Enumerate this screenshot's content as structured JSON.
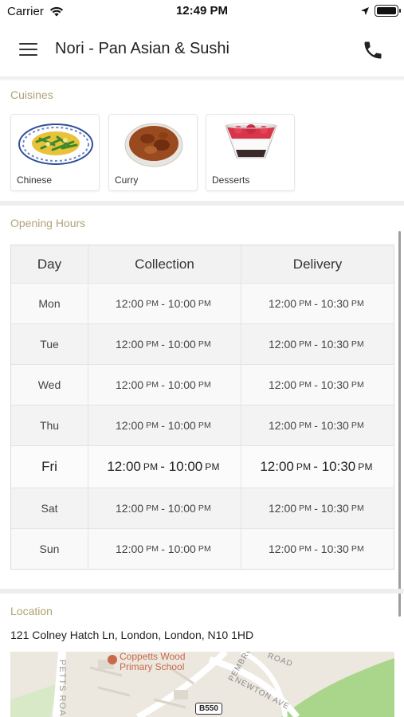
{
  "status_bar": {
    "carrier": "Carrier",
    "time": "12:49 PM"
  },
  "header": {
    "title": "Nori - Pan Asian & Sushi",
    "menu_icon": "hamburger-menu-icon",
    "phone_icon": "phone-icon"
  },
  "cuisines": {
    "heading": "Cuisines",
    "items": [
      {
        "label": "Chinese",
        "image": "stir-fry-plate-image"
      },
      {
        "label": "Curry",
        "image": "curry-bowl-image"
      },
      {
        "label": "Desserts",
        "image": "dessert-glass-image"
      }
    ]
  },
  "opening_hours": {
    "heading": "Opening Hours",
    "columns": [
      "Day",
      "Collection",
      "Delivery"
    ],
    "rows": [
      {
        "day": "Mon",
        "collection": {
          "open": "12:00",
          "open_ampm": "PM",
          "close": "10:00",
          "close_ampm": "PM"
        },
        "delivery": {
          "open": "12:00",
          "open_ampm": "PM",
          "close": "10:30",
          "close_ampm": "PM"
        }
      },
      {
        "day": "Tue",
        "collection": {
          "open": "12:00",
          "open_ampm": "PM",
          "close": "10:00",
          "close_ampm": "PM"
        },
        "delivery": {
          "open": "12:00",
          "open_ampm": "PM",
          "close": "10:30",
          "close_ampm": "PM"
        }
      },
      {
        "day": "Wed",
        "collection": {
          "open": "12:00",
          "open_ampm": "PM",
          "close": "10:00",
          "close_ampm": "PM"
        },
        "delivery": {
          "open": "12:00",
          "open_ampm": "PM",
          "close": "10:30",
          "close_ampm": "PM"
        }
      },
      {
        "day": "Thu",
        "collection": {
          "open": "12:00",
          "open_ampm": "PM",
          "close": "10:00",
          "close_ampm": "PM"
        },
        "delivery": {
          "open": "12:00",
          "open_ampm": "PM",
          "close": "10:30",
          "close_ampm": "PM"
        }
      },
      {
        "day": "Fri",
        "collection": {
          "open": "12:00",
          "open_ampm": "PM",
          "close": "10:00",
          "close_ampm": "PM"
        },
        "delivery": {
          "open": "12:00",
          "open_ampm": "PM",
          "close": "10:30",
          "close_ampm": "PM"
        }
      },
      {
        "day": "Sat",
        "collection": {
          "open": "12:00",
          "open_ampm": "PM",
          "close": "10:00",
          "close_ampm": "PM"
        },
        "delivery": {
          "open": "12:00",
          "open_ampm": "PM",
          "close": "10:30",
          "close_ampm": "PM"
        }
      },
      {
        "day": "Sun",
        "collection": {
          "open": "12:00",
          "open_ampm": "PM",
          "close": "10:00",
          "close_ampm": "PM"
        },
        "delivery": {
          "open": "12:00",
          "open_ampm": "PM",
          "close": "10:30",
          "close_ampm": "PM"
        }
      }
    ]
  },
  "location": {
    "heading": "Location",
    "address": "121 Colney Hatch Ln, London, London, N10 1HD",
    "map": {
      "poi_line1": "Coppetts Wood",
      "poi_line2": "Primary School",
      "roads": [
        "PETTS ROAD",
        "PEMBROKE ROAD",
        "NEWTON AVE",
        "ROAD"
      ],
      "route_badge": "B550"
    }
  },
  "colors": {
    "section_label": "#b0a377",
    "divider": "#eeeeee",
    "map_park": "#a9d68a",
    "map_poi": "#c9684a"
  }
}
